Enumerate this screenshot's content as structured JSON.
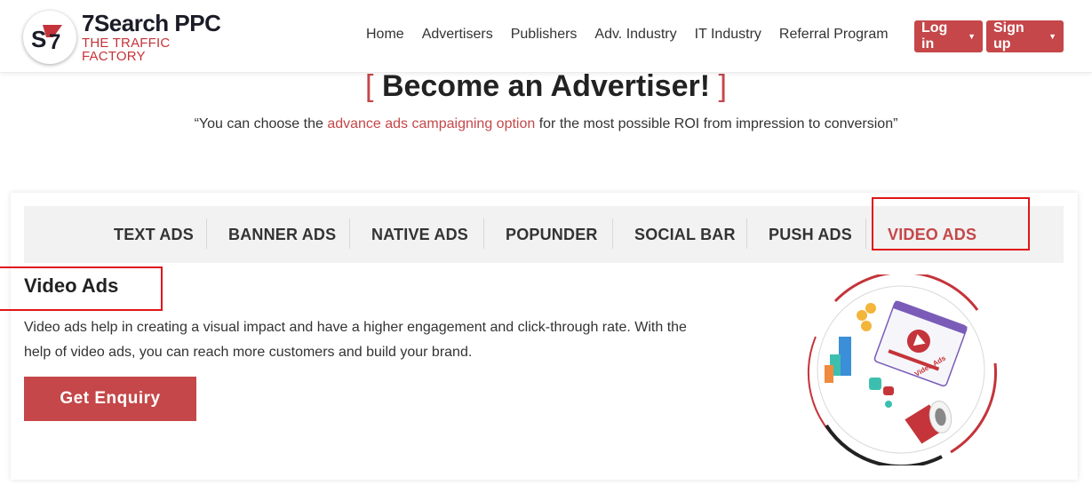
{
  "brand": {
    "name": "7Search PPC",
    "tagline": "THE TRAFFIC FACTORY",
    "logo_mark": "S7",
    "accent_color": "#c54749"
  },
  "nav": {
    "items": [
      "Home",
      "Advertisers",
      "Publishers",
      "Adv. Industry",
      "IT Industry",
      "Referral Program"
    ]
  },
  "auth": {
    "login_label": "Log in",
    "signup_label": "Sign up",
    "caret_icon": "caret-down-icon"
  },
  "hero": {
    "bracket_open": "[",
    "title": "Become an Advertiser!",
    "bracket_close": "]",
    "quote_prefix": "“You can choose the ",
    "quote_highlight": "advance ads campaigning option",
    "quote_suffix": " for the most possible ROI from impression to conversion”"
  },
  "tabs": {
    "items": [
      "TEXT ADS",
      "BANNER ADS",
      "NATIVE ADS",
      "POPUNDER",
      "SOCIAL BAR",
      "PUSH ADS",
      "VIDEO ADS"
    ],
    "active": "VIDEO ADS"
  },
  "panel": {
    "title": "Video Ads",
    "description": "Video ads help in creating a visual impact and have a higher engagement and click-through rate. With the help of video ads, you can reach more customers and build your brand.",
    "button_label": "Get Enquiry",
    "illustration_label": "Video Ads"
  }
}
